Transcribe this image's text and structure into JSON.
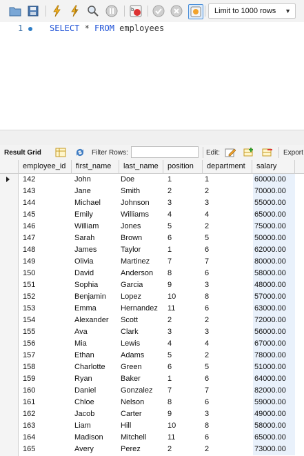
{
  "toolbar": {
    "limit_label": "Limit to 1000 rows",
    "icons": [
      "open-folder-icon",
      "save-icon",
      "execute-icon",
      "execute-current-icon",
      "explain-icon",
      "stop-icon",
      "toggle-error-icon",
      "commit-icon",
      "rollback-icon",
      "autocommit-icon"
    ]
  },
  "editor": {
    "line_number": "1",
    "keyword_select": "SELECT",
    "star": " * ",
    "keyword_from": "FROM",
    "table_name": " employees"
  },
  "result_toolbar": {
    "result_grid_label": "Result Grid",
    "filter_rows_label": "Filter Rows:",
    "filter_value": "",
    "edit_label": "Edit:",
    "export_label": "Export"
  },
  "grid": {
    "columns": [
      "employee_id",
      "first_name",
      "last_name",
      "position",
      "department",
      "salary"
    ],
    "rows": [
      [
        "142",
        "John",
        "Doe",
        "1",
        "1",
        "60000.00"
      ],
      [
        "143",
        "Jane",
        "Smith",
        "2",
        "2",
        "70000.00"
      ],
      [
        "144",
        "Michael",
        "Johnson",
        "3",
        "3",
        "55000.00"
      ],
      [
        "145",
        "Emily",
        "Williams",
        "4",
        "4",
        "65000.00"
      ],
      [
        "146",
        "William",
        "Jones",
        "5",
        "2",
        "75000.00"
      ],
      [
        "147",
        "Sarah",
        "Brown",
        "6",
        "5",
        "50000.00"
      ],
      [
        "148",
        "James",
        "Taylor",
        "1",
        "6",
        "62000.00"
      ],
      [
        "149",
        "Olivia",
        "Martinez",
        "7",
        "7",
        "80000.00"
      ],
      [
        "150",
        "David",
        "Anderson",
        "8",
        "6",
        "58000.00"
      ],
      [
        "151",
        "Sophia",
        "Garcia",
        "9",
        "3",
        "48000.00"
      ],
      [
        "152",
        "Benjamin",
        "Lopez",
        "10",
        "8",
        "57000.00"
      ],
      [
        "153",
        "Emma",
        "Hernandez",
        "11",
        "6",
        "63000.00"
      ],
      [
        "154",
        "Alexander",
        "Scott",
        "2",
        "2",
        "72000.00"
      ],
      [
        "155",
        "Ava",
        "Clark",
        "3",
        "3",
        "56000.00"
      ],
      [
        "156",
        "Mia",
        "Lewis",
        "4",
        "4",
        "67000.00"
      ],
      [
        "157",
        "Ethan",
        "Adams",
        "5",
        "2",
        "78000.00"
      ],
      [
        "158",
        "Charlotte",
        "Green",
        "6",
        "5",
        "51000.00"
      ],
      [
        "159",
        "Ryan",
        "Baker",
        "1",
        "6",
        "64000.00"
      ],
      [
        "160",
        "Daniel",
        "Gonzalez",
        "7",
        "7",
        "82000.00"
      ],
      [
        "161",
        "Chloe",
        "Nelson",
        "8",
        "6",
        "59000.00"
      ],
      [
        "162",
        "Jacob",
        "Carter",
        "9",
        "3",
        "49000.00"
      ],
      [
        "163",
        "Liam",
        "Hill",
        "10",
        "8",
        "58000.00"
      ],
      [
        "164",
        "Madison",
        "Mitchell",
        "11",
        "6",
        "65000.00"
      ],
      [
        "165",
        "Avery",
        "Perez",
        "2",
        "2",
        "73000.00"
      ]
    ]
  }
}
